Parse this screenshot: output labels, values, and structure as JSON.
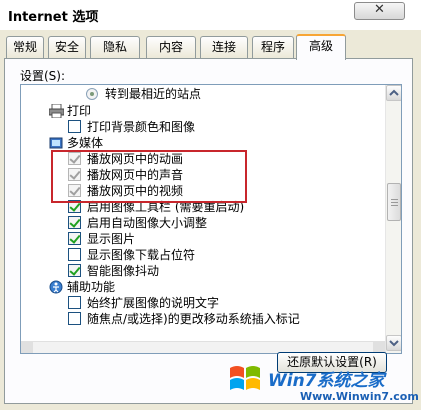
{
  "window": {
    "title": "Internet 选项",
    "close_glyph": "✕"
  },
  "tabs": [
    {
      "label": "常规",
      "active": false
    },
    {
      "label": "安全",
      "active": false
    },
    {
      "label": "隐私",
      "active": false
    },
    {
      "label": "内容",
      "active": false
    },
    {
      "label": "连接",
      "active": false
    },
    {
      "label": "程序",
      "active": false
    },
    {
      "label": "高级",
      "active": true
    }
  ],
  "settings": {
    "label": "设置(S):",
    "items": [
      {
        "type": "radio",
        "label": "转到最相近的站点",
        "checked": true
      },
      {
        "type": "category",
        "label": "打印",
        "icon": "printer-icon"
      },
      {
        "type": "checkbox",
        "label": "打印背景颜色和图像",
        "checked": false
      },
      {
        "type": "category",
        "label": "多媒体",
        "icon": "multimedia-icon"
      },
      {
        "type": "checkbox",
        "label": "播放网页中的动画",
        "checked": true,
        "dim": true
      },
      {
        "type": "checkbox",
        "label": "播放网页中的声音",
        "checked": true,
        "dim": true
      },
      {
        "type": "checkbox",
        "label": "播放网页中的视频",
        "checked": true,
        "dim": true
      },
      {
        "type": "checkbox",
        "label": "启用图像工具栏 (需要重启动)",
        "checked": true
      },
      {
        "type": "checkbox",
        "label": "启用自动图像大小调整",
        "checked": true
      },
      {
        "type": "checkbox",
        "label": "显示图片",
        "checked": true
      },
      {
        "type": "checkbox",
        "label": "显示图像下载占位符",
        "checked": false
      },
      {
        "type": "checkbox",
        "label": "智能图像抖动",
        "checked": true
      },
      {
        "type": "category",
        "label": "辅助功能",
        "icon": "accessibility-icon"
      },
      {
        "type": "checkbox",
        "label": "始终扩展图像的说明文字",
        "checked": false
      },
      {
        "type": "checkbox",
        "label": "随焦点/或选择)的更改移动系统插入标记",
        "checked": false
      }
    ]
  },
  "buttons": {
    "restore_defaults": "还原默认设置(R)"
  },
  "watermark": {
    "brand": "Win7系统之家",
    "url": "Www.Winwin7.com"
  },
  "colors": {
    "highlight": "#c8262c",
    "tab_accent": "#f7a535",
    "check_green": "#21a121"
  }
}
